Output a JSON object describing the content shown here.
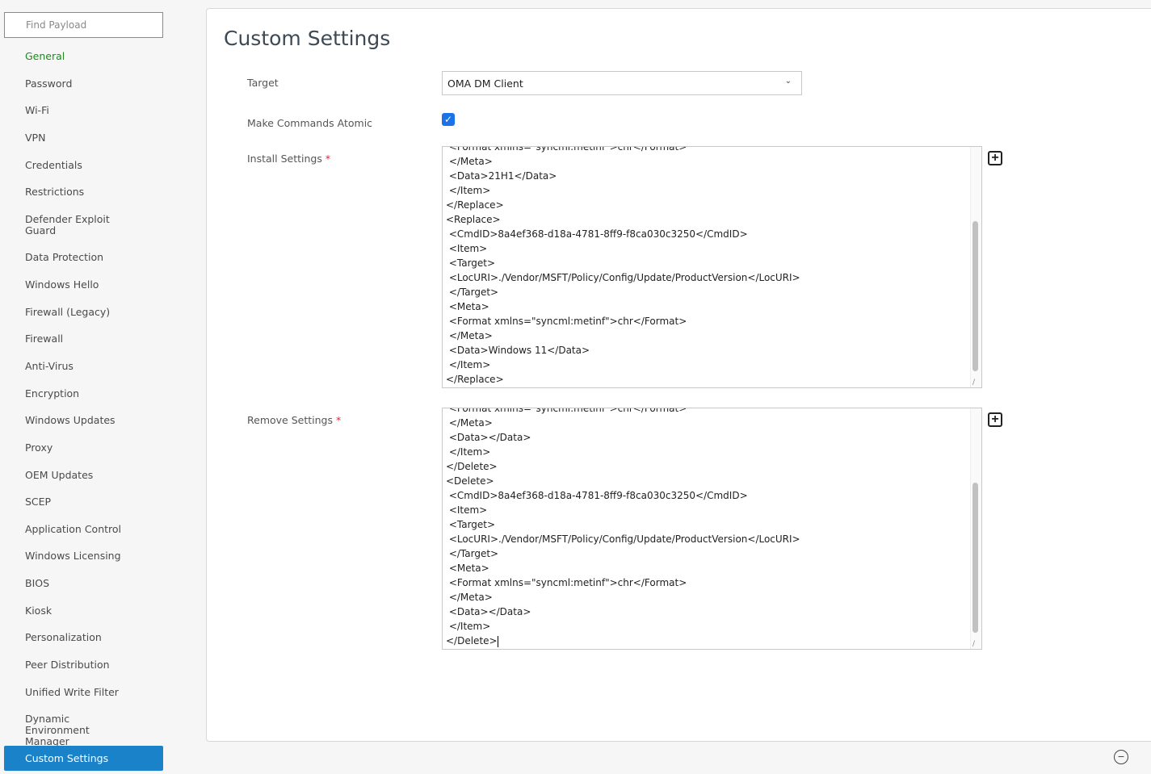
{
  "search": {
    "placeholder": "Find Payload"
  },
  "sidebar": {
    "items": [
      {
        "label": "General",
        "state": "active"
      },
      {
        "label": "Password"
      },
      {
        "label": "Wi-Fi"
      },
      {
        "label": "VPN"
      },
      {
        "label": "Credentials"
      },
      {
        "label": "Restrictions"
      },
      {
        "label": "Defender Exploit Guard"
      },
      {
        "label": "Data Protection"
      },
      {
        "label": "Windows Hello"
      },
      {
        "label": "Firewall (Legacy)"
      },
      {
        "label": "Firewall"
      },
      {
        "label": "Anti-Virus"
      },
      {
        "label": "Encryption"
      },
      {
        "label": "Windows Updates"
      },
      {
        "label": "Proxy"
      },
      {
        "label": "OEM Updates"
      },
      {
        "label": "SCEP"
      },
      {
        "label": "Application Control"
      },
      {
        "label": "Windows Licensing"
      },
      {
        "label": "BIOS"
      },
      {
        "label": "Kiosk"
      },
      {
        "label": "Personalization"
      },
      {
        "label": "Peer Distribution"
      },
      {
        "label": "Unified Write Filter"
      },
      {
        "label": "Dynamic Environment Manager"
      },
      {
        "label": "Custom Settings",
        "state": "selected"
      }
    ]
  },
  "main": {
    "title": "Custom Settings",
    "target_label": "Target",
    "target_value": "OMA DM Client",
    "atomic_label": "Make Commands Atomic",
    "atomic_checked": true,
    "install_label": "Install Settings",
    "remove_label": "Remove Settings",
    "required_mark": "*",
    "install_lines": [
      " <Format xmlns=\"syncml:metinf\">chr</Format>",
      " </Meta>",
      " <Data>21H1</Data>",
      " </Item>",
      "</Replace>",
      "<Replace>",
      " <CmdID>8a4ef368-d18a-4781-8ff9-f8ca030c3250</CmdID>",
      " <Item>",
      " <Target>",
      " <LocURI>./Vendor/MSFT/Policy/Config/Update/ProductVersion</LocURI>",
      " </Target>",
      " <Meta>",
      " <Format xmlns=\"syncml:metinf\">chr</Format>",
      " </Meta>",
      " <Data>Windows 11</Data>",
      " </Item>",
      "</Replace>"
    ],
    "remove_lines": [
      " <Format xmlns=\"syncml:metinf\">chr</Format>",
      " </Meta>",
      " <Data></Data>",
      " </Item>",
      "</Delete>",
      "<Delete>",
      " <CmdID>8a4ef368-d18a-4781-8ff9-f8ca030c3250</CmdID>",
      " <Item>",
      " <Target>",
      " <LocURI>./Vendor/MSFT/Policy/Config/Update/ProductVersion</LocURI>",
      " </Target>",
      " <Meta>",
      " <Format xmlns=\"syncml:metinf\">chr</Format>",
      " </Meta>",
      " <Data></Data>",
      " </Item>",
      "</Delete>"
    ]
  },
  "colors": {
    "accent": "#1a82c8",
    "active": "#1b8a1b",
    "required": "#e23333"
  }
}
